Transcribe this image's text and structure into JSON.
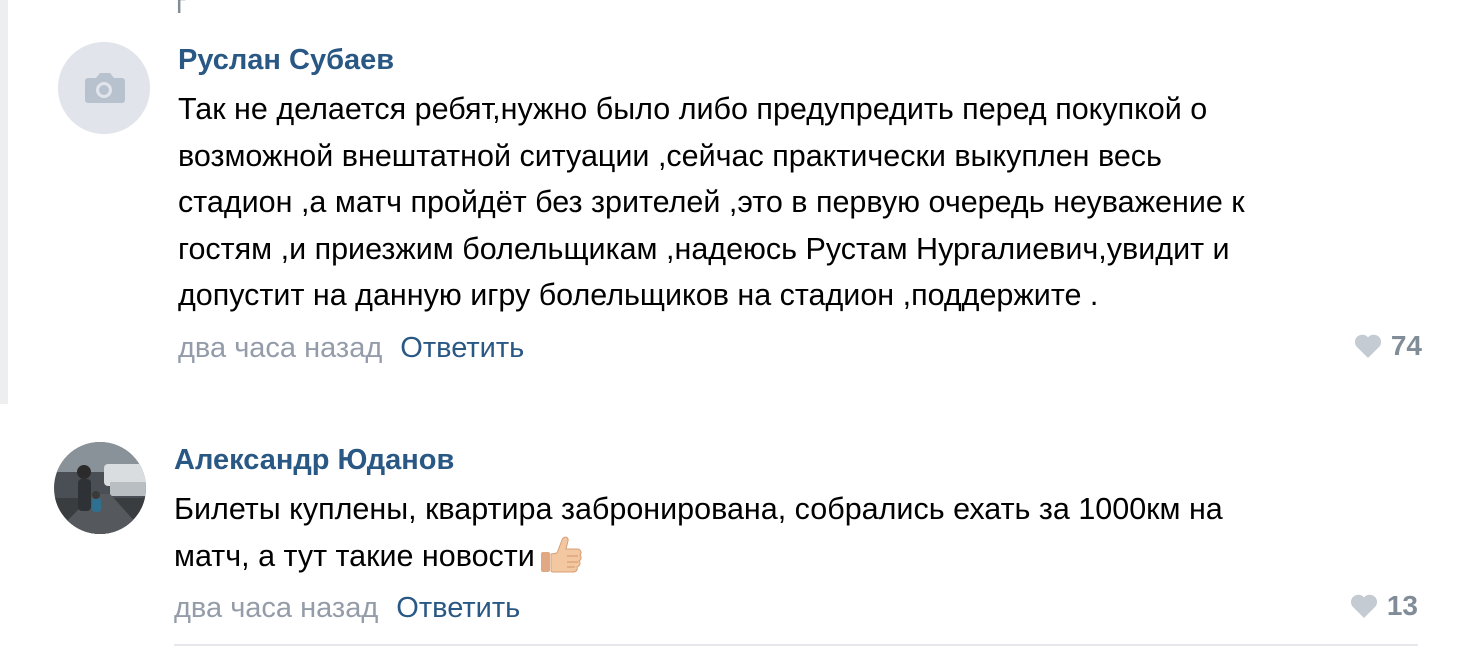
{
  "top_fragment": "г",
  "comments": [
    {
      "author": "Руслан Субаев",
      "avatar_icon": "camera-icon",
      "text_lines": [
        "Так не делается ребят,нужно было либо предупредить перед покупкой о",
        "возможной внештатной ситуации ,сейчас практически выкуплен весь",
        "стадион ,а матч пройдёт без зрителей ,это в первую очередь неуважение к",
        "гостям ,и приезжим болельщикам ,надеюсь Рустам Нургалиевич,увидит и",
        "допустит на данную игру болельщиков на стадион ,поддержите ."
      ],
      "time": "два часа назад",
      "reply_label": "Ответить",
      "likes": "74"
    },
    {
      "author": "Александр Юданов",
      "avatar_icon": "user-photo",
      "text_lines": [
        "Билеты куплены, квартира забронирована, собрались ехать за 1000км на",
        "матч, а тут такие новости"
      ],
      "emoji": "thumbs-up-icon",
      "time": "два часа назад",
      "reply_label": "Ответить",
      "likes": "13"
    }
  ],
  "colors": {
    "author": "#2a5885",
    "meta": "#939ca8",
    "like": "#818c99",
    "divider": "#e7e8ec"
  }
}
